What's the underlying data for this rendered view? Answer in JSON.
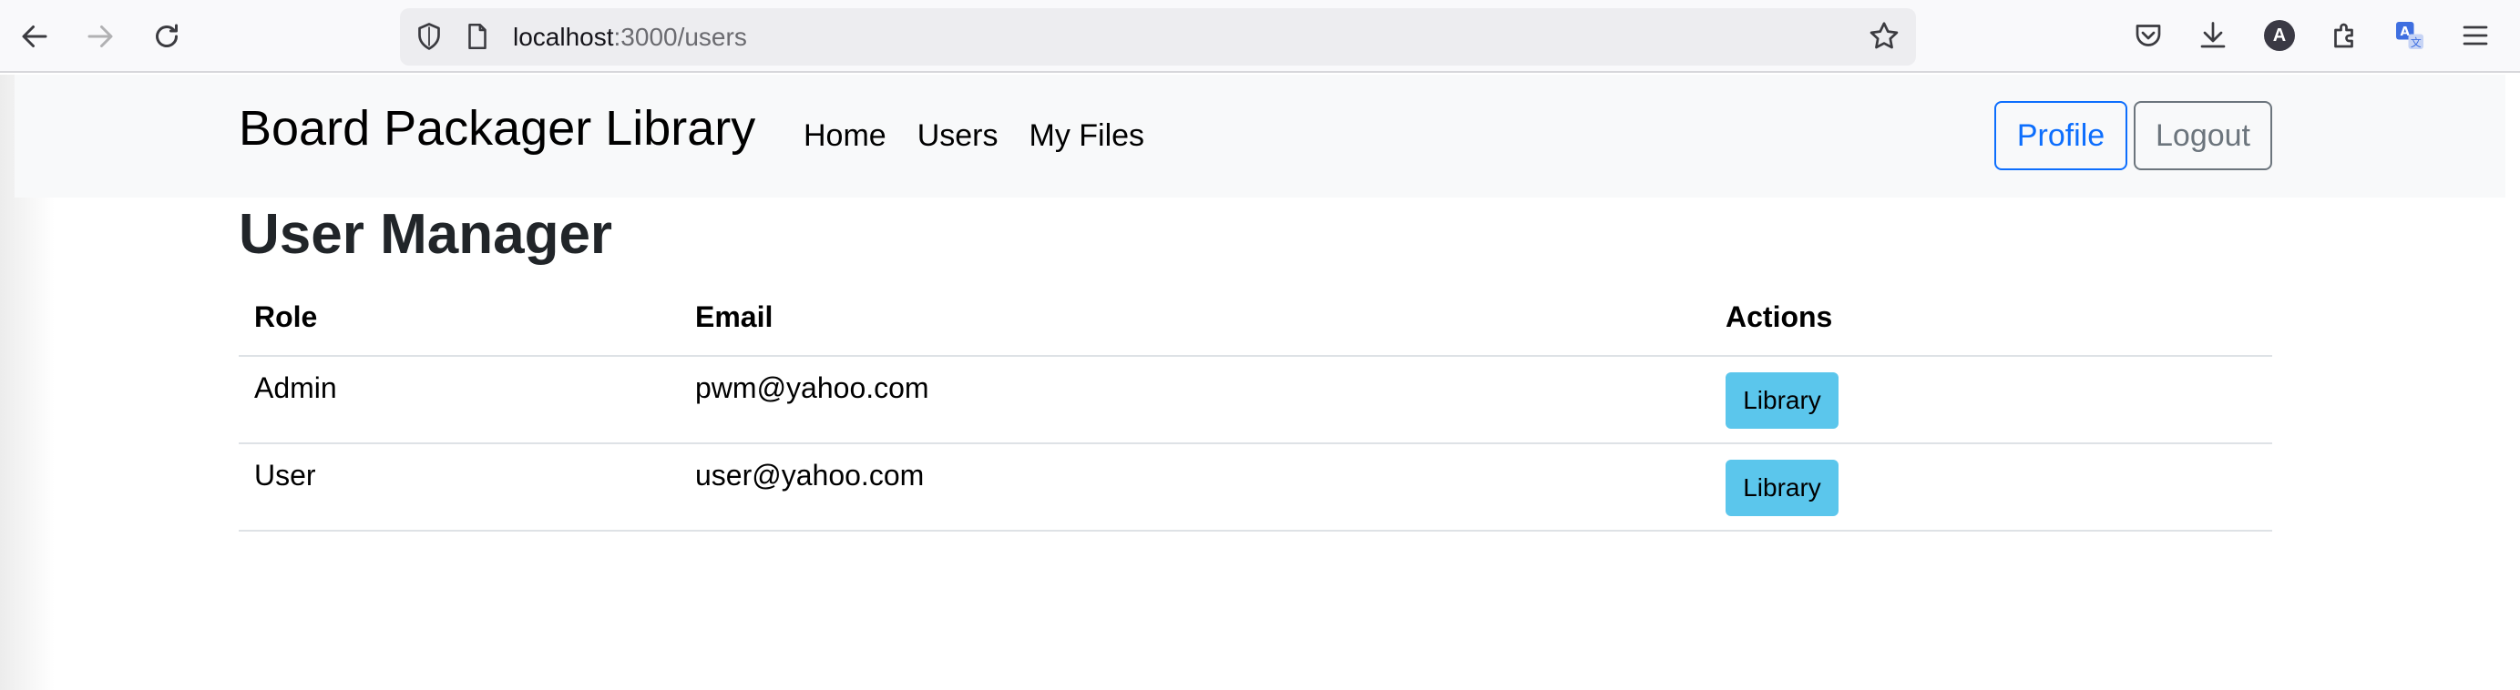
{
  "browser": {
    "url_host": "localhost",
    "url_rest": ":3000/users",
    "avatar_letter": "A"
  },
  "navbar": {
    "brand": "Board Packager Library",
    "links": [
      "Home",
      "Users",
      "My Files"
    ],
    "profile_label": "Profile",
    "logout_label": "Logout"
  },
  "main": {
    "title": "User Manager",
    "table": {
      "headers": [
        "Role",
        "Email",
        "Actions"
      ],
      "rows": [
        {
          "role": "Admin",
          "email": "pwm@yahoo.com",
          "action": "Library"
        },
        {
          "role": "User",
          "email": "user@yahoo.com",
          "action": "Library"
        }
      ]
    }
  },
  "colors": {
    "primary": "#0d6efd",
    "secondary": "#6c757d",
    "info": "#5bc6ec",
    "navbar_bg": "#f8f9fa"
  }
}
